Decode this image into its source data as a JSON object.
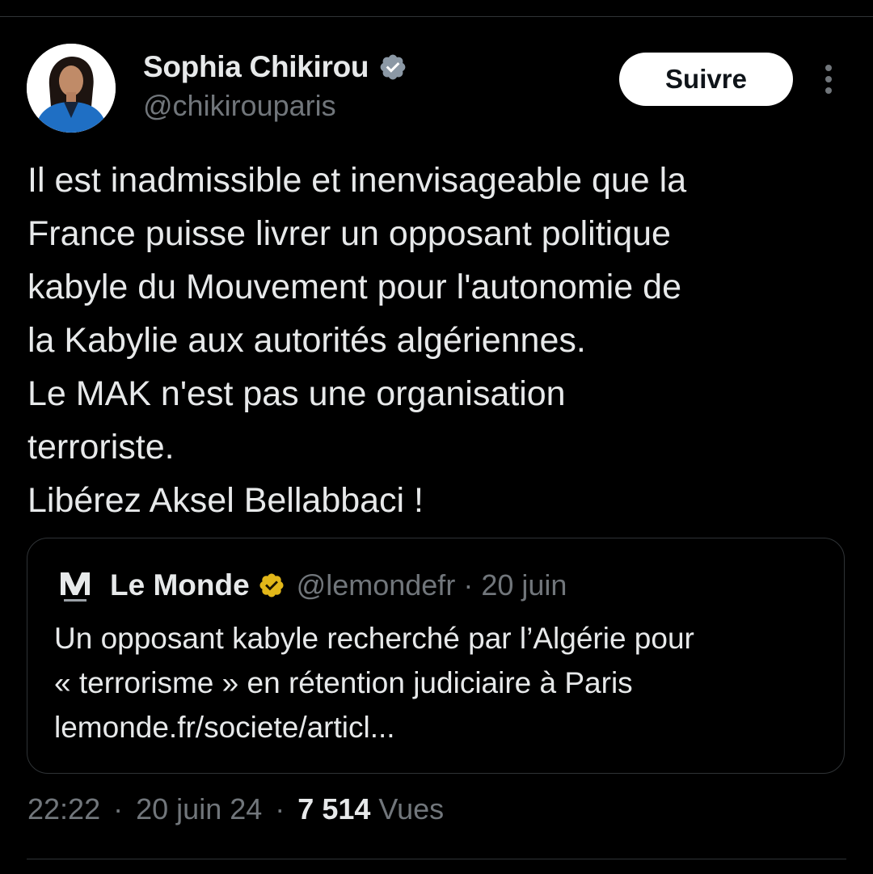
{
  "author": {
    "display_name": "Sophia Chikirou",
    "handle": "@chikirouparis",
    "verified_icon": "verified-badge-blue",
    "badge_color": "#8b98a5"
  },
  "follow_label": "Suivre",
  "tweet": {
    "lines": [
      "Il est inadmissible et inenvisageable que la",
      "France puisse livrer un opposant politique",
      "kabyle du Mouvement pour l'autonomie de",
      "la Kabylie aux autorités algériennes.",
      "Le MAK n'est pas une organisation",
      "terroriste.",
      "Libérez Aksel Bellabbaci !"
    ]
  },
  "quote": {
    "display_name": "Le Monde",
    "handle": "@lemondefr",
    "separator": "·",
    "date": "20 juin",
    "badge_color": "#e2b719",
    "lines": [
      "Un opposant kabyle recherché par l’Algérie pour",
      "« terrorisme » en rétention judiciaire à Paris",
      "lemonde.fr/societe/articl..."
    ]
  },
  "meta": {
    "time": "22:22",
    "separator": "·",
    "date": "20 juin 24",
    "views_count": "7 514",
    "views_label": "Vues"
  },
  "colors": {
    "background": "#000000",
    "text": "#e7e9ea",
    "muted": "#71767b",
    "border": "#2f3336"
  }
}
